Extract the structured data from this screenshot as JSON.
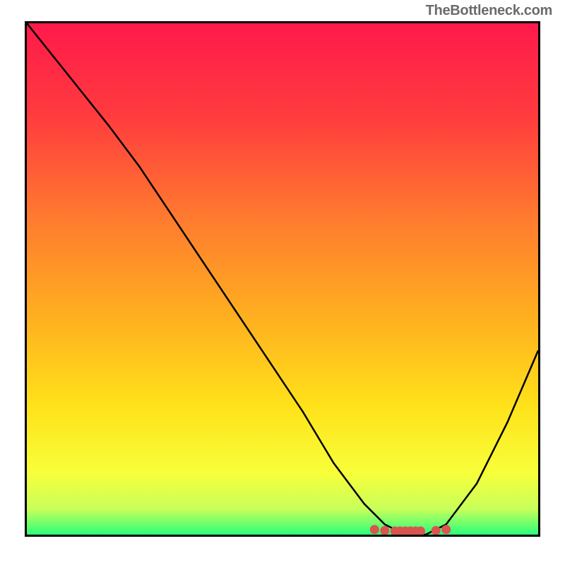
{
  "watermark": "TheBottleneck.com",
  "chart_data": {
    "type": "line",
    "title": "",
    "xlabel": "",
    "ylabel": "",
    "xlim": [
      0,
      100
    ],
    "ylim": [
      0,
      100
    ],
    "gradient_stops": [
      {
        "offset": 0.0,
        "color": "#ff1a4b"
      },
      {
        "offset": 0.18,
        "color": "#ff3b3e"
      },
      {
        "offset": 0.38,
        "color": "#ff7a2f"
      },
      {
        "offset": 0.58,
        "color": "#ffb11f"
      },
      {
        "offset": 0.75,
        "color": "#ffe21a"
      },
      {
        "offset": 0.88,
        "color": "#f7ff3a"
      },
      {
        "offset": 0.95,
        "color": "#c8ff5a"
      },
      {
        "offset": 1.0,
        "color": "#2bff7a"
      }
    ],
    "series": [
      {
        "name": "bottleneck-curve",
        "x": [
          0,
          8,
          16,
          22,
          30,
          38,
          46,
          54,
          60,
          66,
          70,
          74,
          78,
          82,
          88,
          94,
          100
        ],
        "y": [
          100,
          90,
          80,
          72,
          60,
          48,
          36,
          24,
          14,
          6,
          2,
          0,
          0,
          2,
          10,
          22,
          36
        ]
      }
    ],
    "optimal_markers": {
      "name": "optimal-range",
      "color": "#d9544f",
      "points": [
        {
          "x": 68,
          "y": 1.0
        },
        {
          "x": 70,
          "y": 0.8
        },
        {
          "x": 72,
          "y": 0.7
        },
        {
          "x": 73,
          "y": 0.7
        },
        {
          "x": 74,
          "y": 0.7
        },
        {
          "x": 75,
          "y": 0.7
        },
        {
          "x": 76,
          "y": 0.7
        },
        {
          "x": 77,
          "y": 0.7
        },
        {
          "x": 80,
          "y": 0.8
        },
        {
          "x": 82,
          "y": 1.0
        }
      ]
    }
  }
}
